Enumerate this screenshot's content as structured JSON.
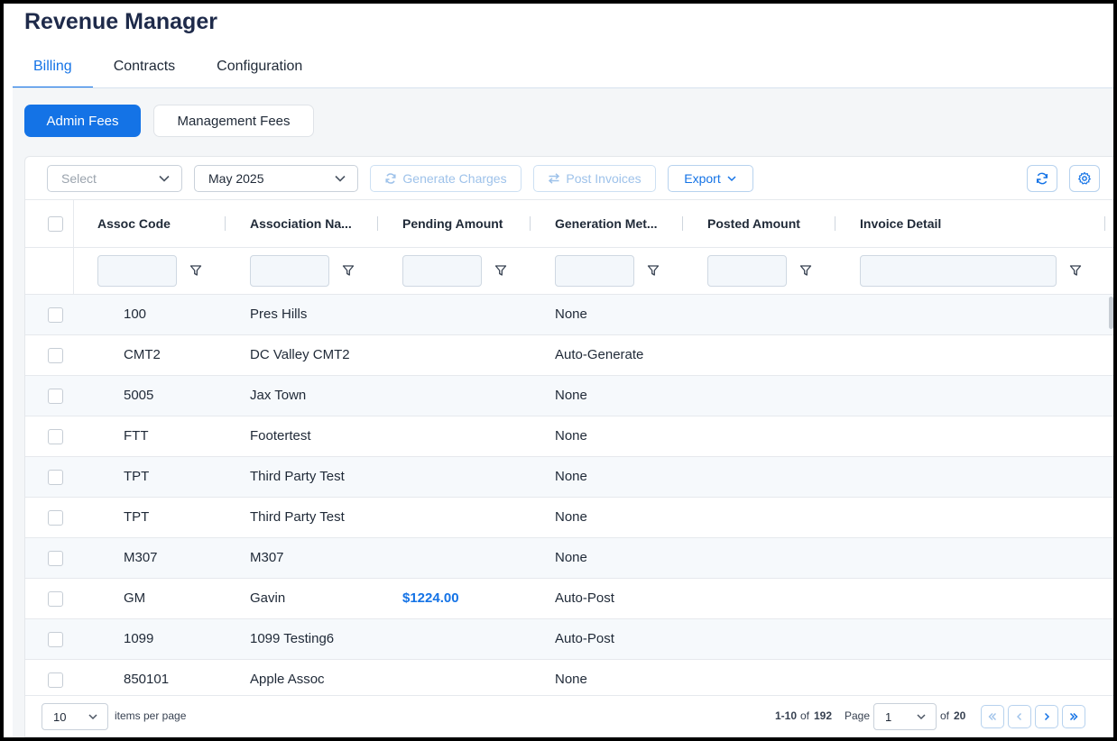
{
  "app": {
    "title": "Revenue Manager"
  },
  "tabs": [
    {
      "label": "Billing",
      "active": true
    },
    {
      "label": "Contracts",
      "active": false
    },
    {
      "label": "Configuration",
      "active": false
    }
  ],
  "segments": {
    "primary": "Admin Fees",
    "secondary": "Management Fees"
  },
  "toolbar": {
    "select_placeholder": "Select",
    "month_value": "May 2025",
    "generate_label": "Generate Charges",
    "post_label": "Post Invoices",
    "export_label": "Export"
  },
  "columns": [
    "Assoc Code",
    "Association Na...",
    "Pending Amount",
    "Generation Met...",
    "Posted Amount",
    "Invoice Detail"
  ],
  "rows": [
    {
      "code": "100",
      "name": "Pres Hills",
      "pending": "",
      "method": "None",
      "posted": "",
      "invoice": ""
    },
    {
      "code": "CMT2",
      "name": "DC Valley CMT2",
      "pending": "",
      "method": "Auto-Generate",
      "posted": "",
      "invoice": ""
    },
    {
      "code": "5005",
      "name": "Jax Town",
      "pending": "",
      "method": "None",
      "posted": "",
      "invoice": ""
    },
    {
      "code": "FTT",
      "name": "Footertest",
      "pending": "",
      "method": "None",
      "posted": "",
      "invoice": ""
    },
    {
      "code": "TPT",
      "name": "Third Party Test",
      "pending": "",
      "method": "None",
      "posted": "",
      "invoice": ""
    },
    {
      "code": "TPT",
      "name": "Third Party Test",
      "pending": "",
      "method": "None",
      "posted": "",
      "invoice": ""
    },
    {
      "code": "M307",
      "name": "M307",
      "pending": "",
      "method": "None",
      "posted": "",
      "invoice": ""
    },
    {
      "code": "GM",
      "name": "Gavin",
      "pending": "$1224.00",
      "method": "Auto-Post",
      "posted": "",
      "invoice": ""
    },
    {
      "code": "1099",
      "name": "1099 Testing6",
      "pending": "",
      "method": "Auto-Post",
      "posted": "",
      "invoice": ""
    },
    {
      "code": "850101",
      "name": "Apple Assoc",
      "pending": "",
      "method": "None",
      "posted": "",
      "invoice": ""
    }
  ],
  "pager": {
    "page_size": "10",
    "items_per_page_label": "items per page",
    "range": "1-10",
    "range_of": "of",
    "total": "192",
    "page_label": "Page",
    "current_page": "1",
    "of_pages_label": "of",
    "total_pages": "20"
  },
  "colors": {
    "accent": "#1473e6",
    "title": "#1e2a4a"
  }
}
